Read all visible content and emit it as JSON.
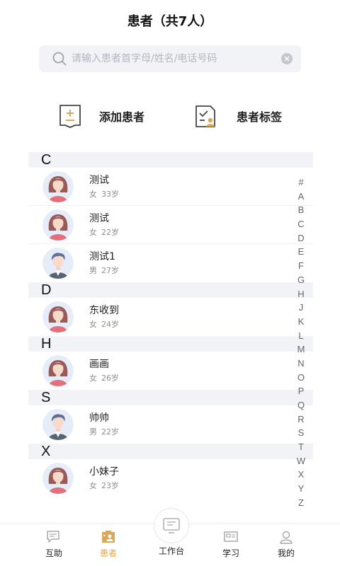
{
  "header": {
    "title": "患者（共7人）"
  },
  "search": {
    "placeholder": "请输入患者首字母/姓名/电话号码",
    "value": ""
  },
  "actions": {
    "add_label": "添加患者",
    "tags_label": "患者标签"
  },
  "sections": [
    {
      "letter": "C",
      "patients": [
        {
          "name": "测试",
          "gender": "女",
          "age": "33岁",
          "avatar": "female-avatar"
        },
        {
          "name": "测试",
          "gender": "女",
          "age": "22岁",
          "avatar": "female-avatar"
        },
        {
          "name": "测试1",
          "gender": "男",
          "age": "27岁",
          "avatar": "male-avatar"
        }
      ]
    },
    {
      "letter": "D",
      "patients": [
        {
          "name": "东收到",
          "gender": "女",
          "age": "24岁",
          "avatar": "female-avatar"
        }
      ]
    },
    {
      "letter": "H",
      "patients": [
        {
          "name": "画画",
          "gender": "女",
          "age": "26岁",
          "avatar": "female-avatar"
        }
      ]
    },
    {
      "letter": "S",
      "patients": [
        {
          "name": "帅帅",
          "gender": "男",
          "age": "22岁",
          "avatar": "male-avatar"
        }
      ]
    },
    {
      "letter": "X",
      "patients": [
        {
          "name": "小妹子",
          "gender": "女",
          "age": "23岁",
          "avatar": "female-avatar"
        }
      ]
    }
  ],
  "index_letters": [
    "#",
    "A",
    "B",
    "C",
    "D",
    "E",
    "F",
    "G",
    "H",
    "J",
    "K",
    "L",
    "M",
    "N",
    "O",
    "P",
    "Q",
    "R",
    "S",
    "T",
    "W",
    "X",
    "Y",
    "Z"
  ],
  "tabbar": {
    "tabs": [
      {
        "label": "互助",
        "icon": "chat-icon"
      },
      {
        "label": "患者",
        "icon": "patients-icon",
        "active": true
      },
      {
        "label": "工作台",
        "icon": "workbench-icon"
      },
      {
        "label": "学习",
        "icon": "study-icon"
      },
      {
        "label": "我的",
        "icon": "profile-icon"
      }
    ]
  },
  "colors": {
    "accent": "#d8a85f",
    "section_bg": "#f2f3f7",
    "search_bg": "#f1f3f7"
  }
}
